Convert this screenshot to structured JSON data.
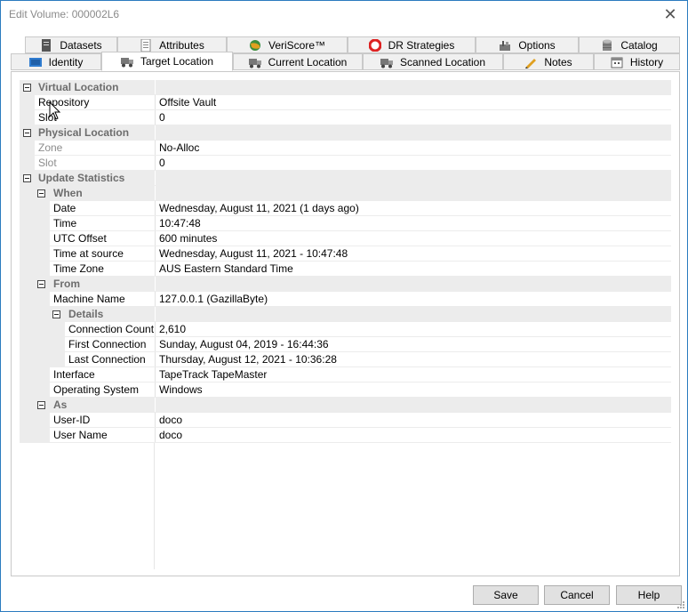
{
  "window": {
    "title": "Edit Volume: 000002L6"
  },
  "tabs_row1": [
    {
      "label": "Datasets",
      "icon": "document-icon"
    },
    {
      "label": "Attributes",
      "icon": "list-icon"
    },
    {
      "label": "VeriScore™",
      "icon": "globe-icon"
    },
    {
      "label": "DR Strategies",
      "icon": "lifebuoy-icon"
    },
    {
      "label": "Options",
      "icon": "tools-icon"
    },
    {
      "label": "Catalog",
      "icon": "database-icon"
    }
  ],
  "tabs_row2": [
    {
      "label": "Identity",
      "icon": "tape-icon"
    },
    {
      "label": "Target Location",
      "icon": "truck-icon",
      "active": true
    },
    {
      "label": "Current Location",
      "icon": "truck-icon"
    },
    {
      "label": "Scanned Location",
      "icon": "truck-icon"
    },
    {
      "label": "Notes",
      "icon": "pencil-icon"
    },
    {
      "label": "History",
      "icon": "calendar-icon"
    }
  ],
  "grid": {
    "virtual_location": {
      "label": "Virtual Location",
      "repository": {
        "name": "Repository",
        "value": "Offsite Vault"
      },
      "slot": {
        "name": "Slot",
        "value": "0"
      }
    },
    "physical_location": {
      "label": "Physical Location",
      "zone": {
        "name": "Zone",
        "value": "No-Alloc"
      },
      "slot": {
        "name": "Slot",
        "value": "0"
      }
    },
    "update_statistics": {
      "label": "Update Statistics",
      "when": {
        "label": "When",
        "date": {
          "name": "Date",
          "value": "Wednesday, August 11, 2021 (1 days ago)"
        },
        "time": {
          "name": "Time",
          "value": "10:47:48"
        },
        "utc_offset": {
          "name": "UTC Offset",
          "value": "600 minutes"
        },
        "time_at_source": {
          "name": "Time at source",
          "value": "Wednesday, August 11, 2021 - 10:47:48"
        },
        "time_zone": {
          "name": "Time Zone",
          "value": "AUS Eastern Standard Time"
        }
      },
      "from": {
        "label": "From",
        "machine_name": {
          "name": "Machine Name",
          "value": "127.0.0.1 (GazillaByte)"
        },
        "details": {
          "label": "Details",
          "connection_count": {
            "name": "Connection Count",
            "value": "2,610"
          },
          "first_connection": {
            "name": "First Connection",
            "value": "Sunday, August 04, 2019 - 16:44:36"
          },
          "last_connection": {
            "name": "Last Connection",
            "value": "Thursday, August 12, 2021 - 10:36:28"
          }
        },
        "interface": {
          "name": "Interface",
          "value": "TapeTrack TapeMaster"
        },
        "operating_system": {
          "name": "Operating System",
          "value": "Windows"
        }
      },
      "as": {
        "label": "As",
        "user_id": {
          "name": "User-ID",
          "value": "doco"
        },
        "user_name": {
          "name": "User Name",
          "value": "doco"
        }
      }
    }
  },
  "buttons": {
    "save": "Save",
    "cancel": "Cancel",
    "help": "Help"
  }
}
